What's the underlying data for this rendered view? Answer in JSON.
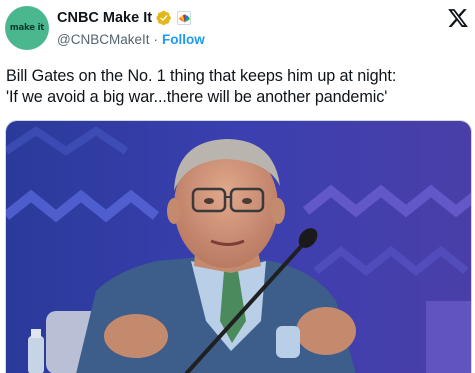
{
  "account": {
    "display_name": "CNBC Make It",
    "handle": "@CNBCMakeIt",
    "separator": "·",
    "follow_label": "Follow",
    "avatar_text": "make it",
    "avatar_color": "#4bb78f",
    "verified_badge": "verified-gold-icon",
    "affiliate_badge": "nbc-peacock-icon"
  },
  "tweet": {
    "text_line1": "Bill Gates on the No. 1 thing that keeps him up at night:",
    "text_line2": "'If we avoid a big war...there will be another pandemic'"
  },
  "media": {
    "kind": "photo",
    "subject": "man-with-microphone"
  },
  "colors": {
    "link": "#1d9bf0",
    "secondary_text": "#536471",
    "verified_gold": "#e2b719"
  }
}
